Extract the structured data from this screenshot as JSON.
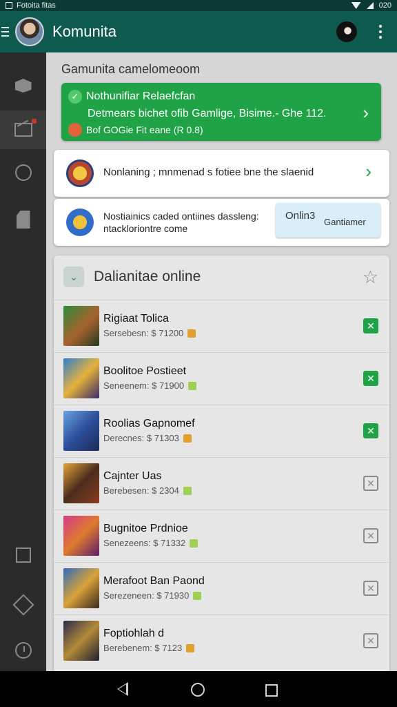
{
  "status_bar": {
    "label": "Fotoita fitas",
    "time": "020"
  },
  "app_bar": {
    "title": "Komunita"
  },
  "breadcrumb": "Gamunita camelomeoom",
  "green_card": {
    "title": "Nothunifiar Relaefcfan",
    "line2": "Detmears bichet ofib Gamlige, Bisime.- Ghe 112.",
    "line3": "Bof GOGie Fit eane (R 0.8)"
  },
  "card_notice": {
    "text": "Nonlaning ; mnmenad s fotiee bne the slaenid"
  },
  "card_contact": {
    "line1": "Nostiainics caded ontiines dassleng:",
    "line2": "ntackloriontre come",
    "status": "Onlin3",
    "button_label": "Gantiamer"
  },
  "list": {
    "title": "Dalianitae online",
    "rows": [
      {
        "title": "Rigiaat Tolica",
        "sub": "Sersebesn: $ 71200",
        "enabled": true
      },
      {
        "title": "Boolitoe Postieet",
        "sub": "Seneenem: $ 71900",
        "enabled": true
      },
      {
        "title": "Roolias Gapnomef",
        "sub": "Derecnes: $ 71303",
        "enabled": true
      },
      {
        "title": "Cajnter Uas",
        "sub": "Berebesen: $ 2304",
        "enabled": false
      },
      {
        "title": "Bugnitoe Prdnioe",
        "sub": "Senezeens: $ 71332",
        "enabled": false
      },
      {
        "title": "Merafoot Ban Paond",
        "sub": "Serezeneen: $ 71930",
        "enabled": false
      },
      {
        "title": "Foptiohlah d",
        "sub": "Berebenem: $ 7123",
        "enabled": false
      }
    ]
  },
  "colors": {
    "accent": "#1fa346",
    "appbar": "#0f5a4e",
    "rail": "#2b2b2b"
  },
  "icons": [
    "menu-icon",
    "box-icon",
    "mail-icon",
    "circle-icon",
    "document-icon",
    "edit-icon",
    "tag-icon",
    "clock-icon",
    "star-icon",
    "chevron-right-icon",
    "check-icon"
  ]
}
